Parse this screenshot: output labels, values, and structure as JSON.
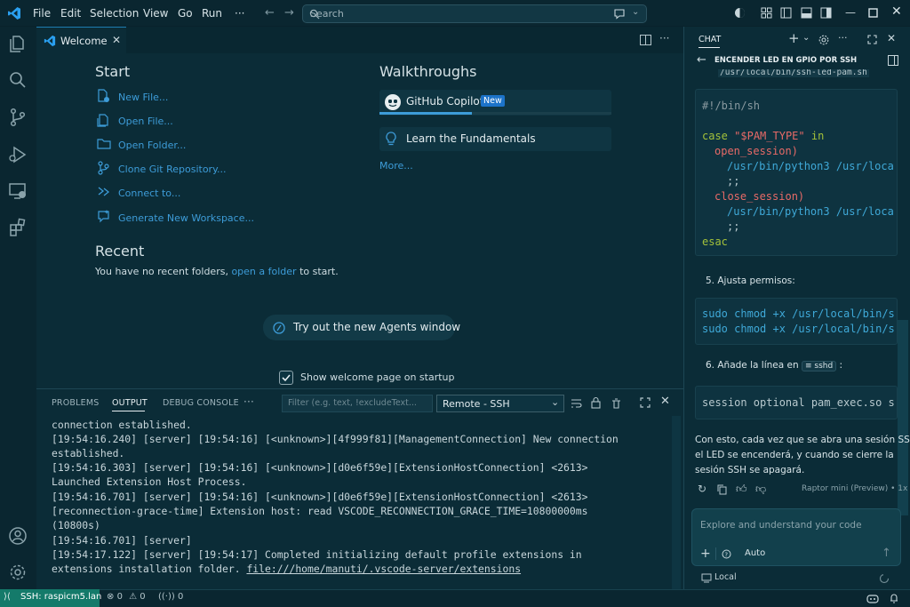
{
  "titlebar": {
    "menu": [
      "File",
      "Edit",
      "Selection",
      "View",
      "Go",
      "Run",
      "···"
    ],
    "search_placeholder": "Search"
  },
  "editor": {
    "tab_label": "Welcome",
    "start_title": "Start",
    "start_items": [
      "New File...",
      "Open File...",
      "Open Folder...",
      "Clone Git Repository...",
      "Connect to...",
      "Generate New Workspace..."
    ],
    "walkthroughs_title": "Walkthroughs",
    "walk_copilot": "GitHub Copilot",
    "walk_copilot_badge": "New",
    "walk_fundamentals": "Learn the Fundamentals",
    "more_link": "More...",
    "recent_title": "Recent",
    "recent_text_before": "You have no recent folders,",
    "recent_link": "open a folder",
    "recent_text_after": "to start.",
    "agents_button": "Try out the new Agents window",
    "show_welcome": "Show welcome page on startup",
    "show_welcome_checked": true
  },
  "panel": {
    "tabs": [
      "PROBLEMS",
      "OUTPUT",
      "DEBUG CONSOLE",
      "···"
    ],
    "active_tab": "OUTPUT",
    "filter_placeholder": "Filter (e.g. text, !excludeText...",
    "channel": "Remote - SSH",
    "lines": [
      "connection established.",
      "[19:54:16.240] [server] [19:54:16] [<unknown>][4f999f81][ManagementConnection] New connection",
      "established.",
      "[19:54:16.303] [server] [19:54:16] [<unknown>][d0e6f59e][ExtensionHostConnection] <2613>",
      "Launched Extension Host Process.",
      "[19:54:16.701] [server] [19:54:16] [<unknown>][d0e6f59e][ExtensionHostConnection] <2613>",
      "[reconnection-grace-time] Extension host: read VSCODE_RECONNECTION_GRACE_TIME=10800000ms",
      "(10800s)",
      "[19:54:16.701] [server]",
      "[19:54:17.122] [server] [19:54:17] Completed initializing default profile extensions in",
      "extensions installation folder."
    ],
    "last_link": "file:///home/manuti/.vscode-server/extensions"
  },
  "chat": {
    "header": "CHAT",
    "title": "ENCENDER LED EN GPIO POR SSH",
    "path_cut": "/usr/local/bin/ssh-led-pam.sh",
    "code1": {
      "shebang": "#!/bin/sh",
      "case_kw": "case",
      "case_var": "\"$PAM_TYPE\"",
      "in_kw": "in",
      "open": "open_session)",
      "open_cmd": "/usr/bin/python3 /usr/loca",
      "sep": ";;",
      "close": "close_session)",
      "close_cmd": "/usr/bin/python3 /usr/loca",
      "esac": "esac"
    },
    "step5": "5. Ajusta permisos:",
    "code2": {
      "sudo": "sudo",
      "chmod": "chmod",
      "rest1": "+x /usr/local/bin/s",
      "rest2": "+x /usr/local/bin/s"
    },
    "step6_before": "6. Añade la línea en",
    "step6_chip": "sshd",
    "step6_after": ":",
    "code3": "session optional pam_exec.so s",
    "conclusion": [
      "Con esto, cada vez que se abra una sesión SSH",
      "el LED se encenderá, y cuando se cierre la",
      "sesión SSH se apagará."
    ],
    "model_note": "Raptor mini (Preview) • 1x",
    "input_placeholder": "Explore and understand your code",
    "mode": "Auto",
    "location": "Local"
  },
  "statusbar": {
    "remote": "SSH: raspicm5.lan",
    "errors": "0",
    "warnings": "0",
    "ports": "0"
  },
  "colors": {
    "accent": "#3d9cd8",
    "remote_bg": "#147a6a",
    "badge_bg": "#1c73c9"
  }
}
